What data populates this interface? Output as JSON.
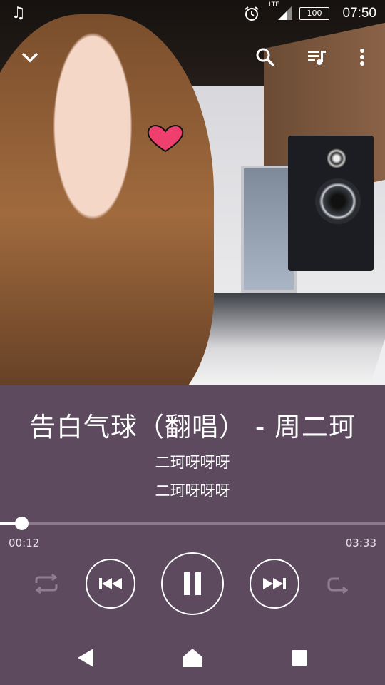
{
  "status_bar": {
    "time": "07:50",
    "battery": "100",
    "network": "LTE"
  },
  "track": {
    "title": "告白气球（翻唱） - 周二珂",
    "artist": "二珂呀呀呀",
    "album": "二珂呀呀呀"
  },
  "playback": {
    "current_time": "00:12",
    "total_time": "03:33",
    "progress_fraction": 0.056,
    "state": "playing"
  },
  "colors": {
    "panel": "#5d4a5f",
    "accent": "#ffffff"
  }
}
